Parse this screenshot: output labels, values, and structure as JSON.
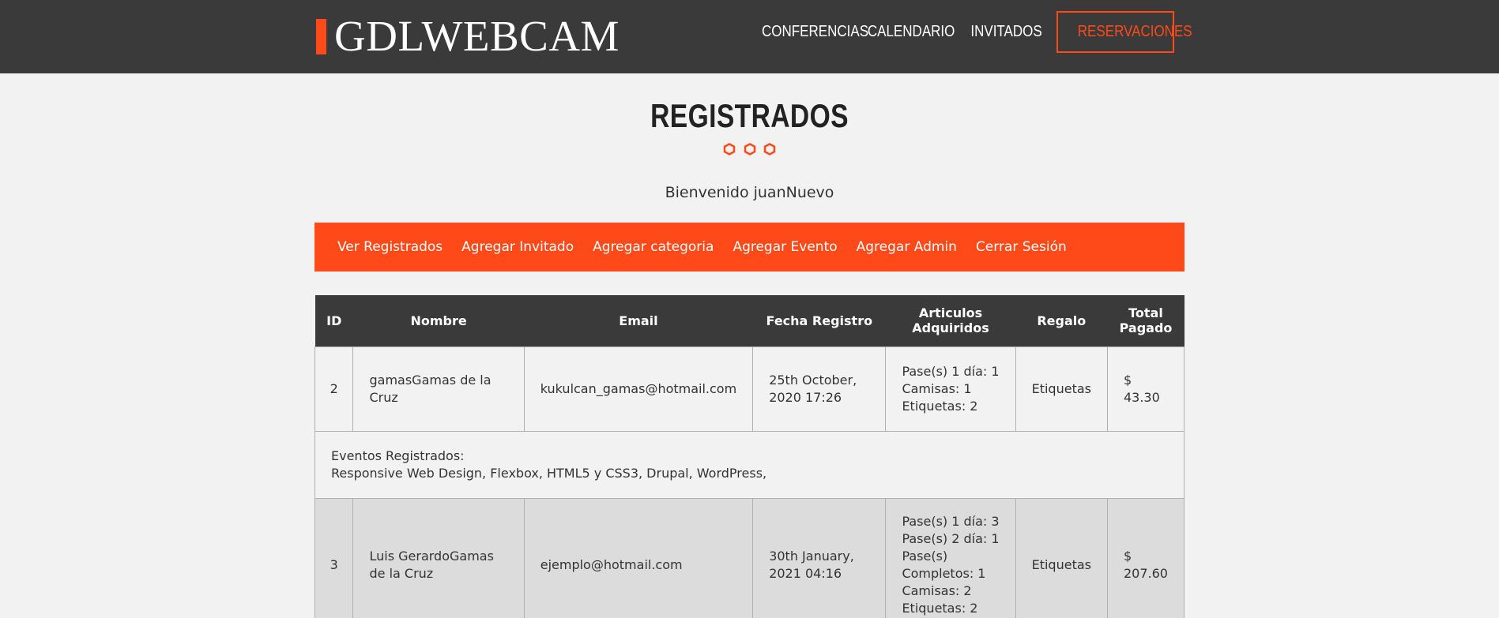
{
  "header": {
    "logo": "GDLWEBCAM",
    "nav": [
      {
        "label": "Conferencias",
        "active": false
      },
      {
        "label": "Calendario",
        "active": false
      },
      {
        "label": "Invitados",
        "active": false
      },
      {
        "label": "Reservaciones",
        "active": true
      }
    ]
  },
  "page": {
    "title": "REGISTRADOS",
    "welcome": "Bienvenido juanNuevo"
  },
  "admin_menu": [
    "Ver Registrados",
    "Agregar Invitado",
    "Agregar categoria",
    "Agregar Evento",
    "Agregar Admin",
    "Cerrar Sesión"
  ],
  "table": {
    "headers": [
      "ID",
      "Nombre",
      "Email",
      "Fecha Registro",
      "Articulos Adquiridos",
      "Regalo",
      "Total Pagado"
    ],
    "rows": [
      {
        "id": "2",
        "nombre": "gamasGamas de la Cruz",
        "email": "kukulcan_gamas@hotmail.com",
        "fecha": "25th October, 2020 17:26",
        "articulos": [
          "Pase(s) 1 día: 1",
          "Camisas: 1",
          "Etiquetas: 2"
        ],
        "regalo": "Etiquetas",
        "total": "$ 43.30",
        "eventos_label": "Eventos Registrados:",
        "eventos": "Responsive Web Design, Flexbox, HTML5 y CSS3, Drupal, WordPress,"
      },
      {
        "id": "3",
        "nombre": "Luis GerardoGamas de la Cruz",
        "email": "ejemplo@hotmail.com",
        "fecha": "30th January, 2021 04:16",
        "articulos": [
          "Pase(s) 1 día: 3",
          "Pase(s) 2 día: 1",
          "Pase(s)",
          "Completos: 1",
          "Camisas: 2",
          "Etiquetas: 2"
        ],
        "regalo": "Etiquetas",
        "total": "$ 207.60"
      }
    ]
  },
  "colors": {
    "accent": "#fe4918",
    "header_bg": "#3a3a3a"
  }
}
